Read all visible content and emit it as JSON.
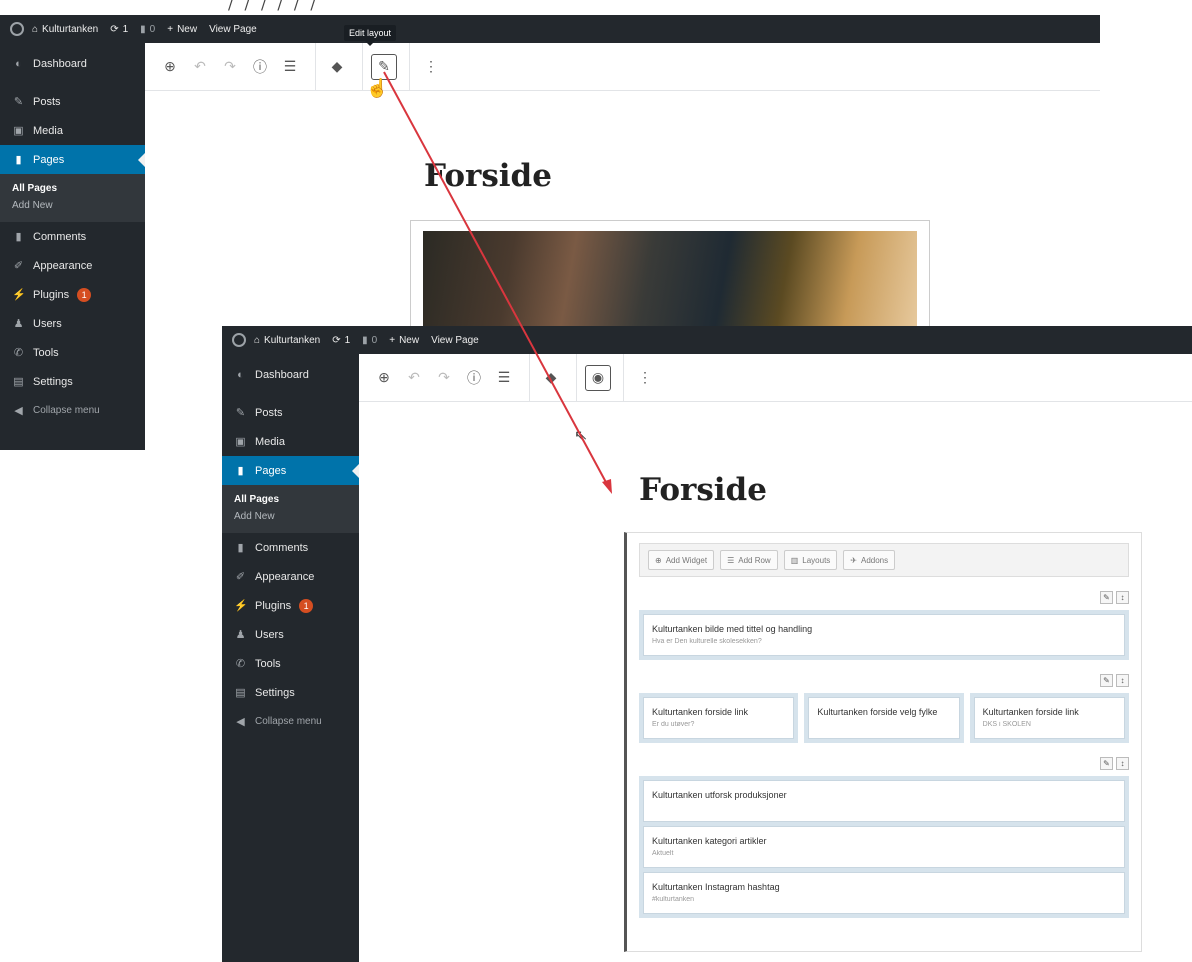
{
  "admin_bar": {
    "site_name": "Kulturtanken",
    "updates": "1",
    "comments": "0",
    "new_label": "New",
    "view_page_label": "View Page"
  },
  "sidebar": {
    "items_top": [
      {
        "label": "Dashboard",
        "icon": "dashboard-icon"
      }
    ],
    "items_mid": [
      {
        "label": "Posts",
        "icon": "pin-icon"
      },
      {
        "label": "Media",
        "icon": "media-icon"
      }
    ],
    "pages": {
      "label": "Pages",
      "icon": "page-icon"
    },
    "submenu": [
      "All Pages",
      "Add New"
    ],
    "items_bottom": [
      {
        "label": "Comments",
        "icon": "comment-icon"
      },
      {
        "label": "Appearance",
        "icon": "brush-icon"
      },
      {
        "label": "Plugins",
        "icon": "plugin-icon",
        "badge": "1"
      },
      {
        "label": "Users",
        "icon": "user-icon"
      },
      {
        "label": "Tools",
        "icon": "wrench-icon"
      },
      {
        "label": "Settings",
        "icon": "settings-icon"
      }
    ],
    "collapse": "Collapse menu"
  },
  "tooltip": "Edit layout",
  "page_title": "Forside",
  "builder": {
    "toolbar": [
      "Add Widget",
      "Add Row",
      "Layouts",
      "Addons"
    ],
    "row1": {
      "title": "Kulturtanken bilde med tittel og handling",
      "sub": "Hva er Den kulturelle skolesekken?"
    },
    "row2": [
      {
        "title": "Kulturtanken forside link",
        "sub": "Er du utøver?"
      },
      {
        "title": "Kulturtanken forside velg fylke",
        "sub": ""
      },
      {
        "title": "Kulturtanken forside link",
        "sub": "DKS i SKOLEN"
      }
    ],
    "row3": [
      {
        "title": "Kulturtanken utforsk produksjoner",
        "sub": ""
      },
      {
        "title": "Kulturtanken kategori artikler",
        "sub": "Aktuelt"
      },
      {
        "title": "Kulturtanken Instagram hashtag",
        "sub": "#kulturtanken"
      }
    ]
  },
  "colors": {
    "admin_bar": "#23282d",
    "active": "#0073aa",
    "arrow": "#d9363e",
    "cell": "#d6e3ec"
  }
}
